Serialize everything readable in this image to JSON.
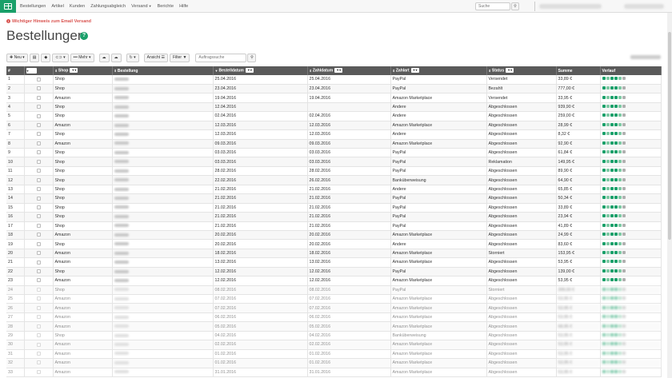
{
  "nav": {
    "items": [
      "Bestellungen",
      "Artikel",
      "Kunden",
      "Zahlungsabgleich",
      "Versand",
      "Berichte",
      "Hilfe"
    ],
    "search_placeholder": "Suche"
  },
  "notice": "Wichtiger Hinweis zum Email Versand",
  "title": "Bestellungen",
  "toolbar": {
    "new_label": "Neu",
    "more_label": "Mehr",
    "view_label": "Ansicht",
    "filter_label": "Filter",
    "search_placeholder": "Auftragssuche"
  },
  "table": {
    "headers": {
      "num": "#",
      "shop": "Shop",
      "order": "Bestellung",
      "order_date": "Bestelldatum",
      "pay_date": "Zahldatum",
      "pay_type": "Zahlart",
      "status": "Status",
      "sum": "Summe",
      "history": "Verlauf"
    },
    "rows": [
      [
        "1",
        "Shop",
        "25.04.2016",
        "25.04.2016",
        "PayPal",
        "Versendet",
        "33,89 €"
      ],
      [
        "2",
        "Shop",
        "23.04.2016",
        "23.04.2016",
        "PayPal",
        "Bezahlt",
        "777,00 €"
      ],
      [
        "3",
        "Amazon",
        "19.04.2016",
        "19.04.2016",
        "Amazon Marketplace",
        "Versendet",
        "33,95 €"
      ],
      [
        "4",
        "Shop",
        "12.04.2016",
        "",
        "Andere",
        "Abgeschlossen",
        "939,90 €"
      ],
      [
        "5",
        "Shop",
        "02.04.2016",
        "02.04.2016",
        "Andere",
        "Abgeschlossen",
        "259,00 €"
      ],
      [
        "6",
        "Amazon",
        "12.03.2016",
        "12.03.2016",
        "Amazon Marketplace",
        "Abgeschlossen",
        "28,99 €"
      ],
      [
        "7",
        "Shop",
        "12.03.2016",
        "12.03.2016",
        "Andere",
        "Abgeschlossen",
        "8,32 €"
      ],
      [
        "8",
        "Amazon",
        "09.03.2016",
        "09.03.2016",
        "Amazon Marketplace",
        "Abgeschlossen",
        "92,90 €"
      ],
      [
        "9",
        "Shop",
        "03.03.2016",
        "03.03.2016",
        "PayPal",
        "Abgeschlossen",
        "61,84 €"
      ],
      [
        "10",
        "Shop",
        "03.03.2016",
        "03.03.2016",
        "PayPal",
        "Reklamation",
        "149,95 €"
      ],
      [
        "11",
        "Shop",
        "28.02.2016",
        "28.02.2016",
        "PayPal",
        "Abgeschlossen",
        "89,90 €"
      ],
      [
        "12",
        "Shop",
        "22.02.2016",
        "26.02.2016",
        "Banküberweisung",
        "Abgeschlossen",
        "64,90 €"
      ],
      [
        "13",
        "Shop",
        "21.02.2016",
        "21.02.2016",
        "Andere",
        "Abgeschlossen",
        "65,85 €"
      ],
      [
        "14",
        "Shop",
        "21.02.2016",
        "21.02.2016",
        "PayPal",
        "Abgeschlossen",
        "50,34 €"
      ],
      [
        "15",
        "Shop",
        "21.02.2016",
        "21.02.2016",
        "PayPal",
        "Abgeschlossen",
        "33,89 €"
      ],
      [
        "16",
        "Shop",
        "21.02.2016",
        "21.02.2016",
        "PayPal",
        "Abgeschlossen",
        "23,94 €"
      ],
      [
        "17",
        "Shop",
        "21.02.2016",
        "21.02.2016",
        "PayPal",
        "Abgeschlossen",
        "41,89 €"
      ],
      [
        "18",
        "Amazon",
        "20.02.2016",
        "20.02.2016",
        "Amazon Marketplace",
        "Abgeschlossen",
        "24,99 €"
      ],
      [
        "19",
        "Shop",
        "20.02.2016",
        "20.02.2016",
        "Andere",
        "Abgeschlossen",
        "83,60 €"
      ],
      [
        "20",
        "Amazon",
        "18.02.2016",
        "18.02.2016",
        "Amazon Marketplace",
        "Storniert",
        "153,95 €"
      ],
      [
        "21",
        "Amazon",
        "13.02.2016",
        "13.02.2016",
        "Amazon Marketplace",
        "Abgeschlossen",
        "53,95 €"
      ],
      [
        "22",
        "Shop",
        "12.02.2016",
        "12.02.2016",
        "PayPal",
        "Abgeschlossen",
        "139,00 €"
      ],
      [
        "23",
        "Amazon",
        "12.02.2016",
        "12.02.2016",
        "Amazon Marketplace",
        "Abgeschlossen",
        "53,95 €"
      ],
      [
        "24",
        "Shop",
        "08.02.2016",
        "08.02.2016",
        "PayPal",
        "Storniert",
        "399,00 €"
      ],
      [
        "25",
        "Amazon",
        "07.02.2016",
        "07.02.2016",
        "Amazon Marketplace",
        "Abgeschlossen",
        "53,95 €"
      ],
      [
        "26",
        "Amazon",
        "07.02.2016",
        "07.02.2016",
        "Amazon Marketplace",
        "Abgeschlossen",
        "53,95 €"
      ],
      [
        "27",
        "Amazon",
        "06.02.2016",
        "06.02.2016",
        "Amazon Marketplace",
        "Abgeschlossen",
        "53,95 €"
      ],
      [
        "28",
        "Amazon",
        "05.02.2016",
        "05.02.2016",
        "Amazon Marketplace",
        "Abgeschlossen",
        "68,95 €"
      ],
      [
        "29",
        "Shop",
        "04.02.2016",
        "04.02.2016",
        "Banküberweisung",
        "Abgeschlossen",
        "53,95 €"
      ],
      [
        "30",
        "Amazon",
        "02.02.2016",
        "02.02.2016",
        "Amazon Marketplace",
        "Abgeschlossen",
        "53,95 €"
      ],
      [
        "31",
        "Amazon",
        "01.02.2016",
        "01.02.2016",
        "Amazon Marketplace",
        "Abgeschlossen",
        "53,95 €"
      ],
      [
        "32",
        "Amazon",
        "01.02.2016",
        "01.02.2016",
        "Amazon Marketplace",
        "Abgeschlossen",
        "53,95 €"
      ],
      [
        "33",
        "Amazon",
        "31.01.2016",
        "31.01.2016",
        "Amazon Marketplace",
        "Abgeschlossen",
        "53,95 €"
      ]
    ]
  },
  "colors": {
    "brand": "#1aa06a",
    "header_bg": "#5a5a5a",
    "notice": "#d9534f"
  }
}
